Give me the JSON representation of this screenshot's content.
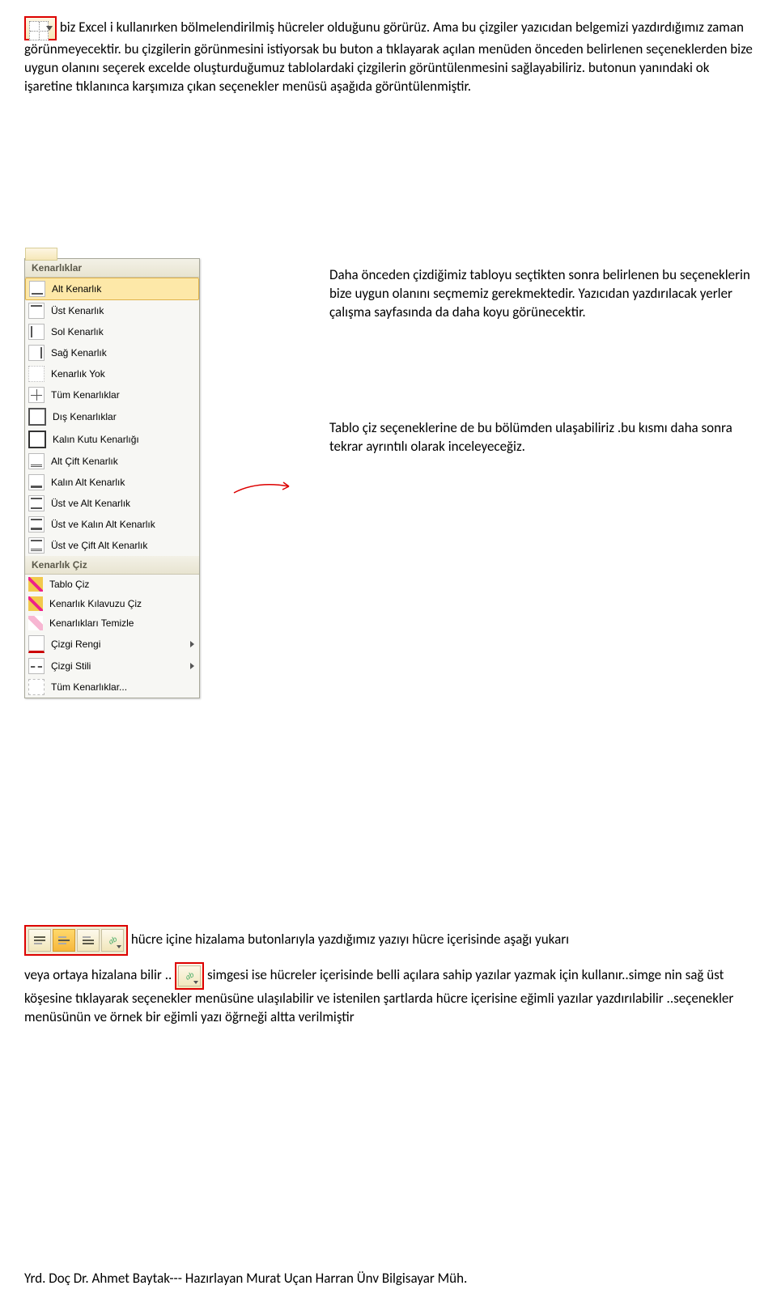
{
  "paragraphs": {
    "p1": "biz Excel i kullanırken bölmelendirilmiş hücreler olduğunu görürüz. Ama bu çizgiler yazıcıdan belgemizi yazdırdığımız zaman görünmeyecektir. bu çizgilerin görünmesini istiyorsak bu buton a tıklayarak açılan menüden önceden belirlenen seçeneklerden bize uygun olanını seçerek excelde oluşturduğumuz tablolardaki çizgilerin görüntülenmesini sağlayabiliriz. butonun yanındaki ok işaretine tıklanınca karşımıza çıkan seçenekler menüsü aşağıda görüntülenmiştir.",
    "side1": "Daha önceden çizdiğimiz tabloyu seçtikten sonra belirlenen bu seçeneklerin bize uygun olanını seçmemiz gerekmektedir. Yazıcıdan yazdırılacak yerler çalışma sayfasında da daha koyu görünecektir.",
    "side2": "Tablo çiz seçeneklerine de bu bölümden ulaşabiliriz .bu kısmı daha sonra tekrar ayrıntılı olarak inceleyeceğiz.",
    "align_part1": "hücre içine hizalama butonlarıyla yazdığımız yazıyı hücre içerisinde aşağı yukarı",
    "align_part2a": "veya ortaya hizalana bilir ..",
    "align_part2b": "simgesi ise hücreler içerisinde belli açılara sahip yazılar yazmak için kullanır..simge nin sağ üst köşesine tıklayarak seçenekler menüsüne ulaşılabilir ve istenilen şartlarda hücre içerisine eğimli yazılar yazdırılabilir ..seçenekler menüsünün ve örnek bir eğimli yazı öğrneği altta verilmiştir"
  },
  "menu": {
    "section1": "Kenarlıklar",
    "items1": [
      "Alt Kenarlık",
      "Üst Kenarlık",
      "Sol Kenarlık",
      "Sağ Kenarlık",
      "Kenarlık Yok",
      "Tüm Kenarlıklar",
      "Dış Kenarlıklar",
      "Kalın Kutu Kenarlığı",
      "Alt Çift Kenarlık",
      "Kalın Alt Kenarlık",
      "Üst ve Alt Kenarlık",
      "Üst ve Kalın Alt Kenarlık",
      "Üst ve Çift Alt Kenarlık"
    ],
    "section2": "Kenarlık Çiz",
    "items2": [
      "Tablo Çiz",
      "Kenarlık Kılavuzu Çiz",
      "Kenarlıkları Temizle",
      "Çizgi Rengi",
      "Çizgi Stili",
      "Tüm Kenarlıklar..."
    ]
  },
  "footer": "Yrd. Doç Dr. Ahmet Baytak--- Hazırlayan Murat Uçan Harran Ünv Bilgisayar Müh."
}
